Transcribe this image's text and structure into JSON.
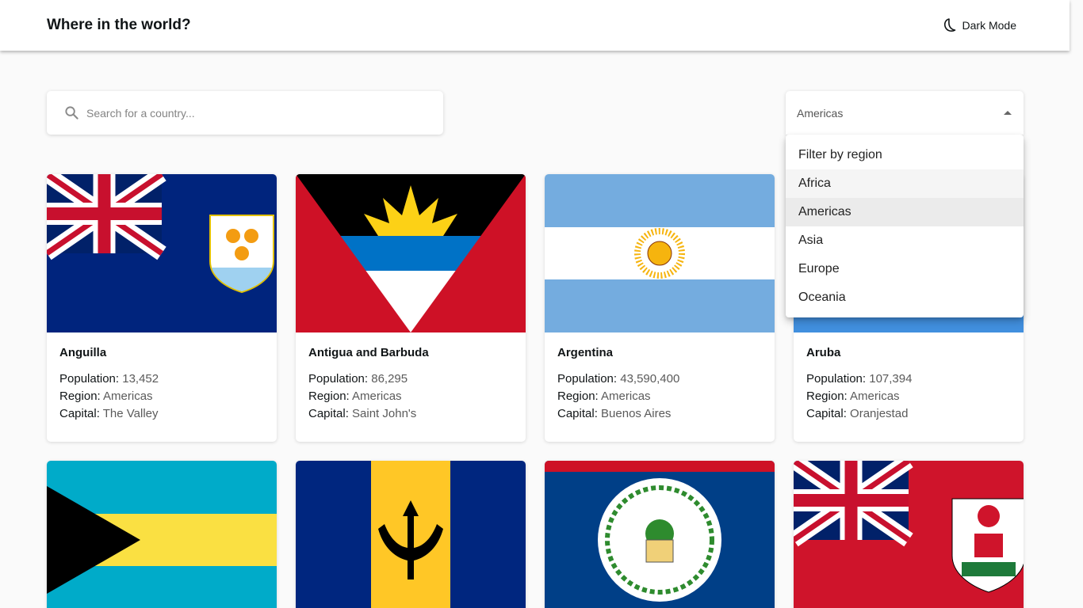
{
  "header": {
    "title": "Where in the world?",
    "dark_mode_label": "Dark Mode"
  },
  "search": {
    "placeholder": "Search for a country..."
  },
  "filter": {
    "selected": "Americas",
    "options": [
      "Filter by region",
      "Africa",
      "Americas",
      "Asia",
      "Europe",
      "Oceania"
    ]
  },
  "labels": {
    "population": "Population:",
    "region": "Region:",
    "capital": "Capital:"
  },
  "countries": [
    {
      "name": "Anguilla",
      "population": "13,452",
      "region": "Americas",
      "capital": "The Valley"
    },
    {
      "name": "Antigua and Barbuda",
      "population": "86,295",
      "region": "Americas",
      "capital": "Saint John's"
    },
    {
      "name": "Argentina",
      "population": "43,590,400",
      "region": "Americas",
      "capital": "Buenos Aires"
    },
    {
      "name": "Aruba",
      "population": "107,394",
      "region": "Americas",
      "capital": "Oranjestad"
    }
  ],
  "second_row_flags": [
    "bahamas-flag",
    "barbados-flag",
    "belize-flag",
    "bermuda-flag"
  ],
  "colors": {
    "background": "#fafafa",
    "surface": "#ffffff",
    "text": "#111517",
    "muted": "#848484"
  }
}
